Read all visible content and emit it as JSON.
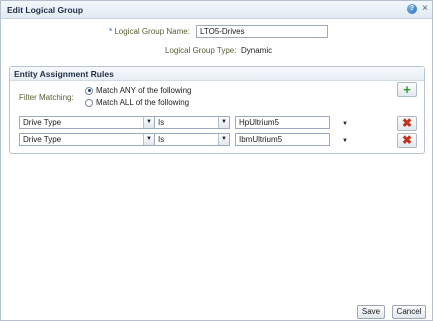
{
  "dialog": {
    "title": "Edit Logical Group",
    "help_icon": "question-mark-icon",
    "close_icon": "close-x-icon"
  },
  "form": {
    "required_marker": "*",
    "name_label": "Logical Group Name:",
    "name_value": "LTO5-Drives",
    "type_label": "Logical Group Type:",
    "type_value": "Dynamic"
  },
  "rules": {
    "section_title": "Entity Assignment Rules",
    "filter_label": "Filter Matching:",
    "options": [
      {
        "label": "Match ANY of the following",
        "checked": true
      },
      {
        "label": "Match ALL of the following",
        "checked": false
      }
    ],
    "add_icon": "green-plus-icon",
    "remove_icon": "red-x-icon",
    "rows": [
      {
        "field": "Drive Type",
        "operator": "Is",
        "value": "HpUltrium5"
      },
      {
        "field": "Drive Type",
        "operator": "Is",
        "value": "IbmUltrium5"
      }
    ]
  },
  "footer": {
    "save_label": "Save",
    "cancel_label": "Cancel"
  }
}
